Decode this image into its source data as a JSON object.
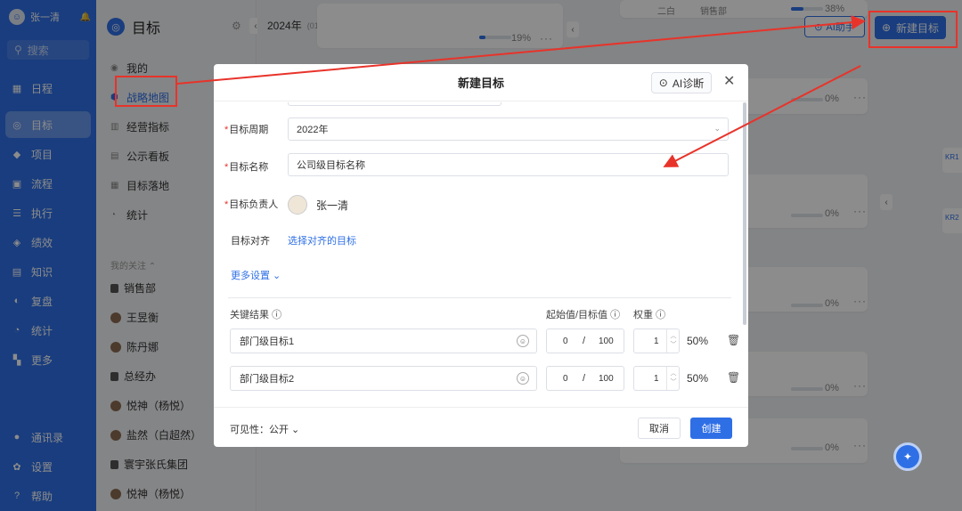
{
  "rail": {
    "username": "张一清",
    "search_placeholder": "搜索",
    "nav": [
      {
        "label": "日程",
        "icon": "calendar-icon",
        "glyph": "▦"
      },
      {
        "label": "目标",
        "icon": "target-icon",
        "glyph": "◎",
        "active": true
      },
      {
        "label": "项目",
        "icon": "cube-icon",
        "glyph": "◆"
      },
      {
        "label": "流程",
        "icon": "flow-icon",
        "glyph": "▣"
      },
      {
        "label": "执行",
        "icon": "checklist-icon",
        "glyph": "☰"
      },
      {
        "label": "绩效",
        "icon": "performance-icon",
        "glyph": "◈"
      },
      {
        "label": "知识",
        "icon": "book-icon",
        "glyph": "▤"
      },
      {
        "label": "复盘",
        "icon": "review-icon",
        "glyph": "◐"
      },
      {
        "label": "统计",
        "icon": "pie-chart-icon",
        "glyph": "◔"
      },
      {
        "label": "更多",
        "icon": "grid-icon",
        "glyph": "▚"
      }
    ],
    "bottom": [
      {
        "label": "通讯录",
        "icon": "contacts-icon",
        "glyph": "●"
      },
      {
        "label": "设置",
        "icon": "settings-icon",
        "glyph": "✿"
      },
      {
        "label": "帮助",
        "icon": "help-icon",
        "glyph": "?"
      }
    ]
  },
  "side": {
    "title": "目标",
    "items": [
      {
        "label": "我的",
        "icon": "person-icon"
      },
      {
        "label": "战略地图",
        "icon": "map-icon",
        "active": true
      },
      {
        "label": "经营指标",
        "icon": "metrics-icon"
      },
      {
        "label": "公示看板",
        "icon": "board-icon"
      },
      {
        "label": "目标落地",
        "icon": "landing-icon"
      },
      {
        "label": "统计",
        "icon": "stats-icon"
      }
    ],
    "follow_title": "我的关注",
    "follows": [
      {
        "label": "销售部",
        "type": "dept"
      },
      {
        "label": "王昱衡",
        "type": "user"
      },
      {
        "label": "陈丹娜",
        "type": "user"
      },
      {
        "label": "总经办",
        "type": "dept"
      },
      {
        "label": "悦神（杨悦）",
        "type": "user"
      },
      {
        "label": "盐然（白超然）",
        "type": "user"
      },
      {
        "label": "寰宇张氏集团",
        "type": "dept"
      },
      {
        "label": "悦神（杨悦）",
        "type": "user"
      }
    ]
  },
  "main": {
    "year": "2024年",
    "year_range": "(01.01-12.31)",
    "card1_progress": "19%",
    "card_top_progress": "38%",
    "card_top_tag1": "二白",
    "card_top_tag2": "销售部",
    "right_progress": [
      "0%",
      "0%",
      "0%",
      "0%",
      "0%",
      "0%"
    ],
    "ai_helper_label": "AI助手",
    "new_goal_label": "新建目标",
    "kr_tags": [
      "KR1",
      "KR2"
    ]
  },
  "modal": {
    "title": "新建目标",
    "ai_diag_label": "AI诊断",
    "period_label": "目标周期",
    "period_value": "2022年",
    "name_label": "目标名称",
    "name_value": "公司级目标名称",
    "owner_label": "目标负责人",
    "owner_name": "张一清",
    "align_label": "目标对齐",
    "align_link": "选择对齐的目标",
    "more_settings": "更多设置",
    "kr_header": "关键结果",
    "value_header": "起始值/目标值",
    "weight_header": "权重",
    "krs": [
      {
        "name": "部门级目标1",
        "start": "0",
        "target": "100",
        "weight": "1",
        "pct": "50%"
      },
      {
        "name": "部门级目标2",
        "start": "0",
        "target": "100",
        "weight": "1",
        "pct": "50%"
      }
    ],
    "visibility": "可见性：公开",
    "cancel": "取消",
    "create": "创建"
  },
  "colors": {
    "primary": "#2f6fe6",
    "annotation_red": "#e8332a"
  }
}
